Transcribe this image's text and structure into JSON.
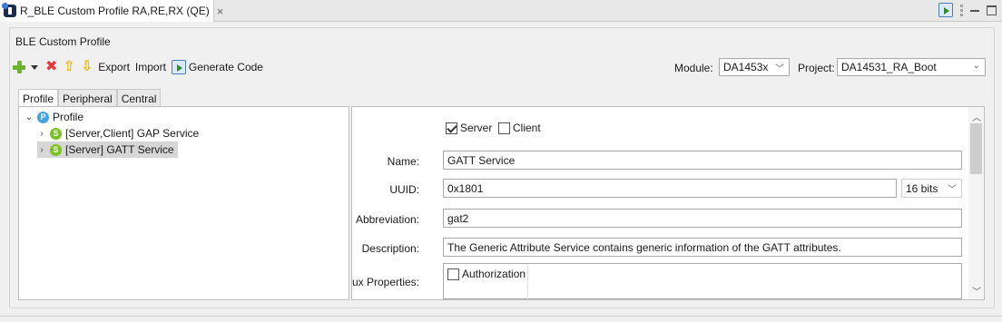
{
  "editor_tab": {
    "title": "R_BLE Custom Profile RA,RE,RX (QE)",
    "close_glyph": "×",
    "icon": "app-icon"
  },
  "window_icons": [
    "generate-icon",
    "more-icon",
    "minimize-icon",
    "maximize-icon"
  ],
  "group": {
    "title": "BLE Custom Profile"
  },
  "toolbar": {
    "icons": [
      "add-icon",
      "dropdown-icon",
      "delete-icon",
      "move-up-icon",
      "move-down-icon",
      "generate-code-icon"
    ],
    "export_label": "Export",
    "import_label": "Import",
    "generate_label": "Generate Code"
  },
  "module": {
    "label": "Module:",
    "value": "DA1453x"
  },
  "project": {
    "label": "Project:",
    "value": "DA14531_RA_Boot"
  },
  "subtabs": [
    {
      "label": "Profile",
      "active": true
    },
    {
      "label": "Peripheral",
      "active": false
    },
    {
      "label": "Central",
      "active": false
    }
  ],
  "tree": {
    "root": {
      "label": "Profile",
      "badge": "P",
      "expanded": true
    },
    "items": [
      {
        "label": "[Server,Client] GAP Service",
        "badge": "S",
        "selected": false
      },
      {
        "label": "[Server] GATT Service",
        "badge": "S",
        "selected": true
      }
    ]
  },
  "detail": {
    "server": {
      "label": "Server",
      "checked": true
    },
    "client": {
      "label": "Client",
      "checked": false
    },
    "name": {
      "label": "Name:",
      "value": "GATT Service"
    },
    "uuid": {
      "label": "UUID:",
      "value": "0x1801",
      "size": "16 bits"
    },
    "abbreviation": {
      "label": "Abbreviation:",
      "value": "gat2"
    },
    "description": {
      "label": "Description:",
      "value": "The Generic Attribute Service contains generic information of the GATT attributes."
    },
    "aux": {
      "label": "Aux Properties:",
      "authorization": {
        "label": "Authorization",
        "checked": false
      }
    }
  },
  "colors": {
    "accent_green": "#79c225",
    "accent_blue": "#47a3e0",
    "delete_red": "#e53935",
    "arrow_yellow": "#f0b400"
  }
}
